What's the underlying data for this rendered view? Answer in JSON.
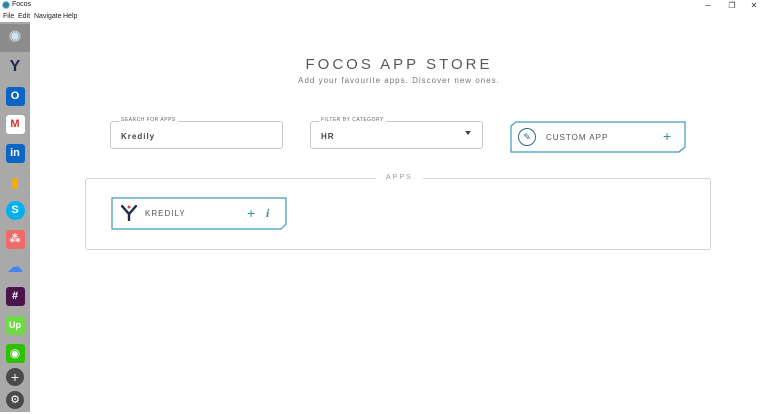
{
  "window": {
    "title": "Focos",
    "minimize": "─",
    "maximize": "❐",
    "close": "✕"
  },
  "menu": {
    "items": [
      "File",
      "Edit",
      "Navigate",
      "Help"
    ]
  },
  "sidebar": {
    "apps": [
      {
        "name": "focos",
        "icon": "focos-logo-icon",
        "glyph": "✺",
        "color": "#2f7fa5"
      },
      {
        "name": "kredily",
        "icon": "kredily-icon",
        "glyph": "Y",
        "color": "#1f2a44"
      },
      {
        "name": "outlook",
        "icon": "outlook-icon",
        "glyph": "O",
        "color": "#0a64c2"
      },
      {
        "name": "gmail",
        "icon": "gmail-icon",
        "glyph": "M",
        "color": "#d93025"
      },
      {
        "name": "linkedin",
        "icon": "linkedin-icon",
        "glyph": "in",
        "color": "#0a66c2"
      },
      {
        "name": "google-analytics",
        "icon": "analytics-icon",
        "glyph": "▮",
        "color": "#f9ab00"
      },
      {
        "name": "skype",
        "icon": "skype-icon",
        "glyph": "S",
        "color": "#00aff0"
      },
      {
        "name": "asana",
        "icon": "asana-icon",
        "glyph": "⁂",
        "color": "#f06a6a"
      },
      {
        "name": "google-cloud",
        "icon": "cloud-icon",
        "glyph": "☁",
        "color": "#4285f4"
      },
      {
        "name": "slack",
        "icon": "slack-icon",
        "glyph": "#",
        "color": "#4a154b"
      },
      {
        "name": "upwork",
        "icon": "upwork-icon",
        "glyph": "Up",
        "color": "#6fda44"
      },
      {
        "name": "wechat",
        "icon": "wechat-icon",
        "glyph": "◉",
        "color": "#2dc100"
      }
    ],
    "add_glyph": "+",
    "settings_glyph": "⚙"
  },
  "store": {
    "title": "FOCOS APP STORE",
    "subtitle": "Add your favourite apps. Discover new ones."
  },
  "search": {
    "label": "SEARCH FOR APPS",
    "value": "Kredily"
  },
  "filter": {
    "label": "FILTER BY CATEGORY",
    "value": "HR"
  },
  "custom_app": {
    "label": "CUSTOM APP",
    "icon": "wrench-icon",
    "glyph": "✎",
    "plus": "+"
  },
  "apps_section": {
    "label": "APPS",
    "items": [
      {
        "name": "KREDILY",
        "icon": "kredily-icon",
        "plus": "+",
        "info": "i"
      }
    ]
  },
  "colors": {
    "accent": "#2d8fb0",
    "sidebar": "#a9a9a9",
    "card_border": "#3f9bb8"
  }
}
